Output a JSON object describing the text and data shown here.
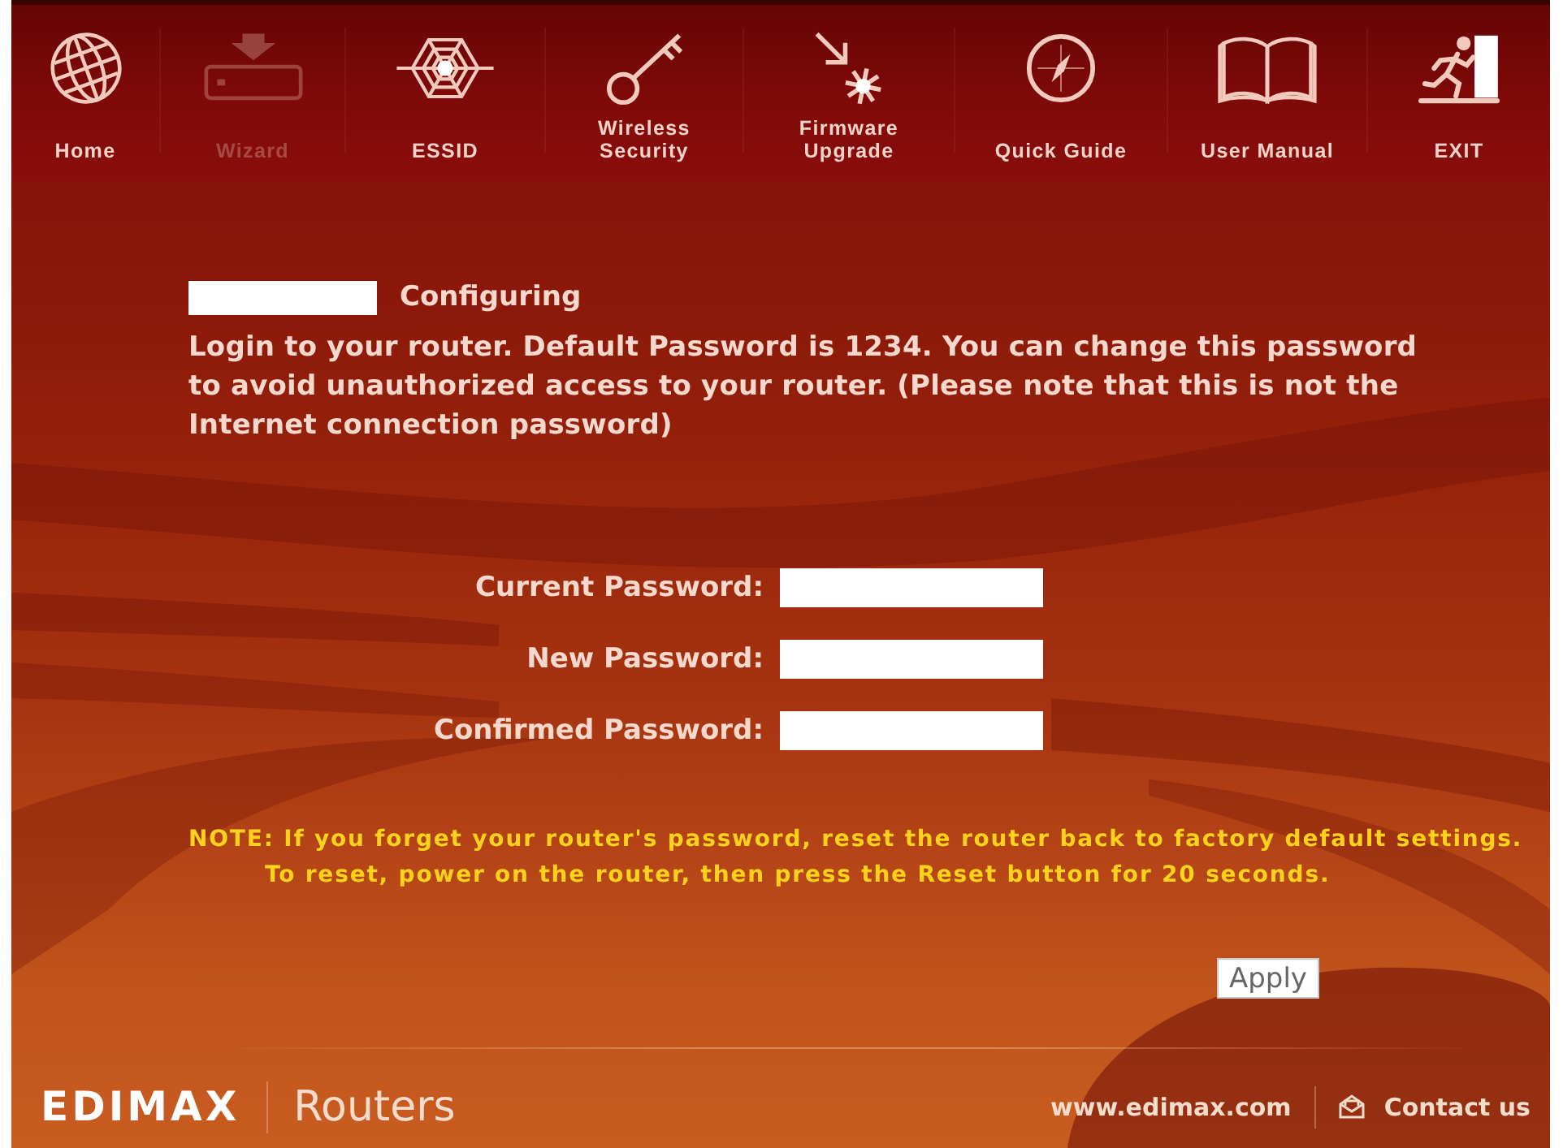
{
  "nav": {
    "items": [
      {
        "label": "Home",
        "disabled": false
      },
      {
        "label": "Wizard",
        "disabled": true
      },
      {
        "label": "ESSID",
        "disabled": false
      },
      {
        "label": "Wireless\nSecurity",
        "disabled": false
      },
      {
        "label": "Firmware\nUpgrade",
        "disabled": false
      },
      {
        "label": "Quick Guide",
        "disabled": false
      },
      {
        "label": "User Manual",
        "disabled": false
      },
      {
        "label": "EXIT",
        "disabled": false
      }
    ]
  },
  "status": {
    "label": "Configuring"
  },
  "intro": "Login to your router. Default Password is 1234. You can change this password to avoid unauthorized access to your router. (Please note that this is not the Internet connection password)",
  "form": {
    "fields": [
      {
        "label": "Current Password:"
      },
      {
        "label": "New Password:"
      },
      {
        "label": "Confirmed Password:"
      }
    ]
  },
  "note": {
    "lines": [
      "NOTE: If you forget your router's password, reset the router back to factory default settings.",
      "To reset, power on the router, then press the Reset button for 20 seconds."
    ]
  },
  "apply_button": "Apply",
  "footer": {
    "logo": "EDIMAX",
    "section": "Routers",
    "website": "www.edimax.com",
    "contact": "Contact us"
  }
}
